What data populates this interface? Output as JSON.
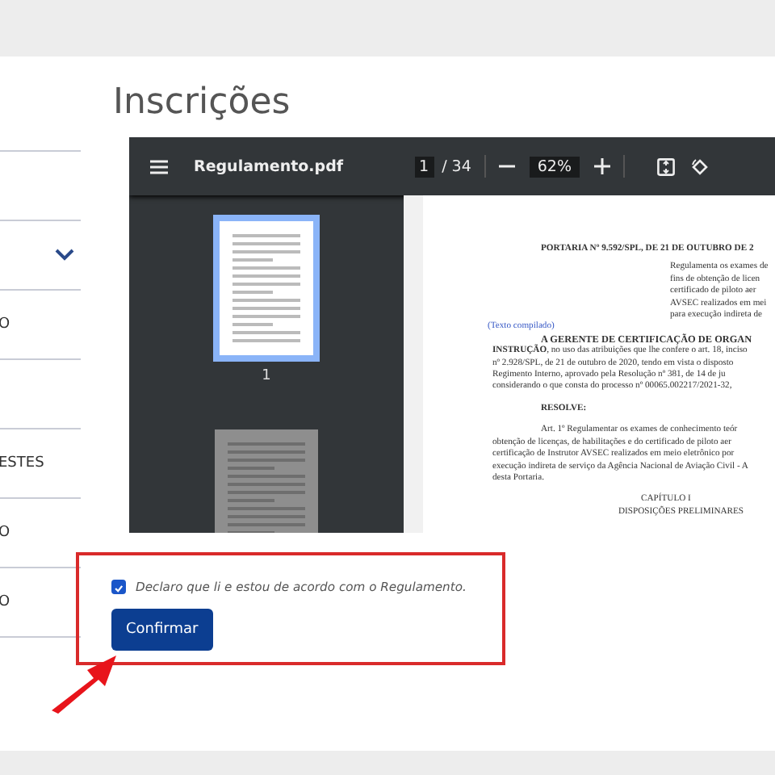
{
  "sidebar": {
    "items": [
      {
        "kind": "blank"
      },
      {
        "kind": "collapsible",
        "expanded": false
      },
      {
        "kind": "text",
        "label": "O"
      },
      {
        "kind": "blank"
      },
      {
        "kind": "text",
        "label": "ESTES"
      },
      {
        "kind": "text",
        "label": "O"
      },
      {
        "kind": "text",
        "label": "O"
      }
    ]
  },
  "page_title": "Inscrições",
  "pdf_viewer": {
    "file_name": "Regulamento.pdf",
    "page": "1",
    "page_total": "/ 34",
    "zoom": "62%",
    "thumbnails": [
      {
        "label": "1",
        "selected": true
      },
      {
        "selected": false
      }
    ],
    "document": {
      "title": "PORTARIA Nº 9.592/SPL, DE 21 DE OUTUBRO DE 2",
      "summary": [
        "Regulamenta os exames de",
        "fins de obtenção de licen",
        "certificado de piloto aer",
        "AVSEC realizados em mei",
        "para execução indireta de"
      ],
      "note": "(Texto compilado)",
      "heading": "A GERENTE DE CERTIFICAÇÃO DE ORGAN",
      "intro": [
        "**INSTRUÇÃO**, no uso das atribuições que lhe confere o art. 18, inciso",
        "nº 2.928/SPL, de 21 de outubro de 2020, tendo em vista o disposto",
        "Regimento Interno, aprovado pela Resolução nº 381, de 14 de ju",
        "considerando o que consta do processo nº 00065.002217/2021-32,"
      ],
      "resolve": "RESOLVE:",
      "article": [
        "Art. 1º Regulamentar os exames de conhecimento teór",
        "obtenção de licenças, de habilitações e do certificado de piloto aer",
        "certificação de Instrutor AVSEC realizados em meio eletrônico por",
        "execução indireta de serviço da Agência Nacional de Aviação Civil - A",
        "desta Portaria."
      ],
      "chapter": "CAPÍTULO I",
      "chapter_title": "DISPOSIÇÕES PRELIMINARES"
    }
  },
  "agreement": {
    "checked": true,
    "label": "Declaro que li e estou de acordo com o Regulamento.",
    "button": "Confirmar"
  }
}
